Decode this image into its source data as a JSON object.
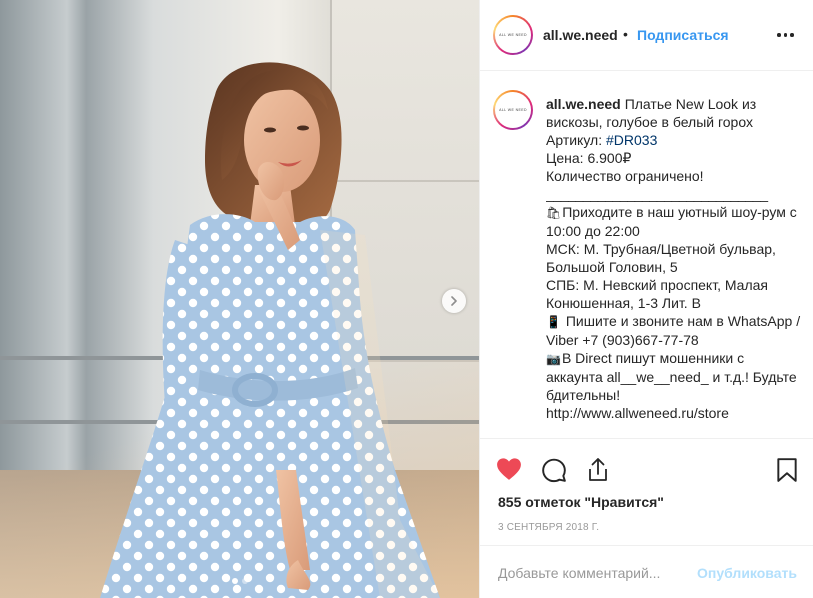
{
  "post": {
    "media": {
      "alt_icon": "photo-of-woman-in-polka-dot-dress",
      "carousel_next_icon": "chevron-right-icon",
      "carousel_dots": 2,
      "active_dot": 0
    },
    "header": {
      "avatar_text": "ALL WE NEED",
      "username": "all.we.need",
      "separator": "•",
      "follow_label": "Подписаться",
      "more_icon": "more-options-icon"
    },
    "caption": {
      "avatar_text": "ALL WE NEED",
      "username": "all.we.need",
      "text_1": "Платье New Look из вискозы, голубое в белый горох",
      "sku_label": "Артикул: ",
      "sku_tag": "#DR033",
      "price": "Цена: 6.900₽",
      "quantity": "Количество ограничено!",
      "divider": "______________________________",
      "shop_emoji": "🛍",
      "showroom": "Приходите в наш уютный шоу-рум с 10:00 до 22:00",
      "msk": "МСК: М. Трубная/Цветной бульвар, Большой Головин, 5",
      "spb": "СПБ: М. Невский проспект, Малая Конюшенная, 1-3 Лит. В",
      "phone_emoji": "📱",
      "contact": " Пишите и звоните нам в WhatsApp / Viber +7 (903)667-77-78",
      "warning_emoji": "📷",
      "warning": "В Direct пишут мошенники с аккаунта all__we__need_ и т.д.! Будьте бдительны!",
      "url": "http://www.allweneed.ru/store"
    },
    "actions": {
      "like_icon": "heart-filled-icon",
      "comment_icon": "comment-icon",
      "share_icon": "share-icon",
      "save_icon": "bookmark-icon",
      "like_color": "#ed4956",
      "likes_text": "855 отметок \"Нравится\"",
      "date": "3 сентября 2018 г."
    },
    "comment_box": {
      "placeholder": "Добавьте комментарий...",
      "publish_label": "Опубликовать"
    },
    "colors": {
      "link_blue": "#3897f0",
      "publish_disabled": "#b2dffc",
      "text": "#262626",
      "muted": "#999999"
    }
  }
}
